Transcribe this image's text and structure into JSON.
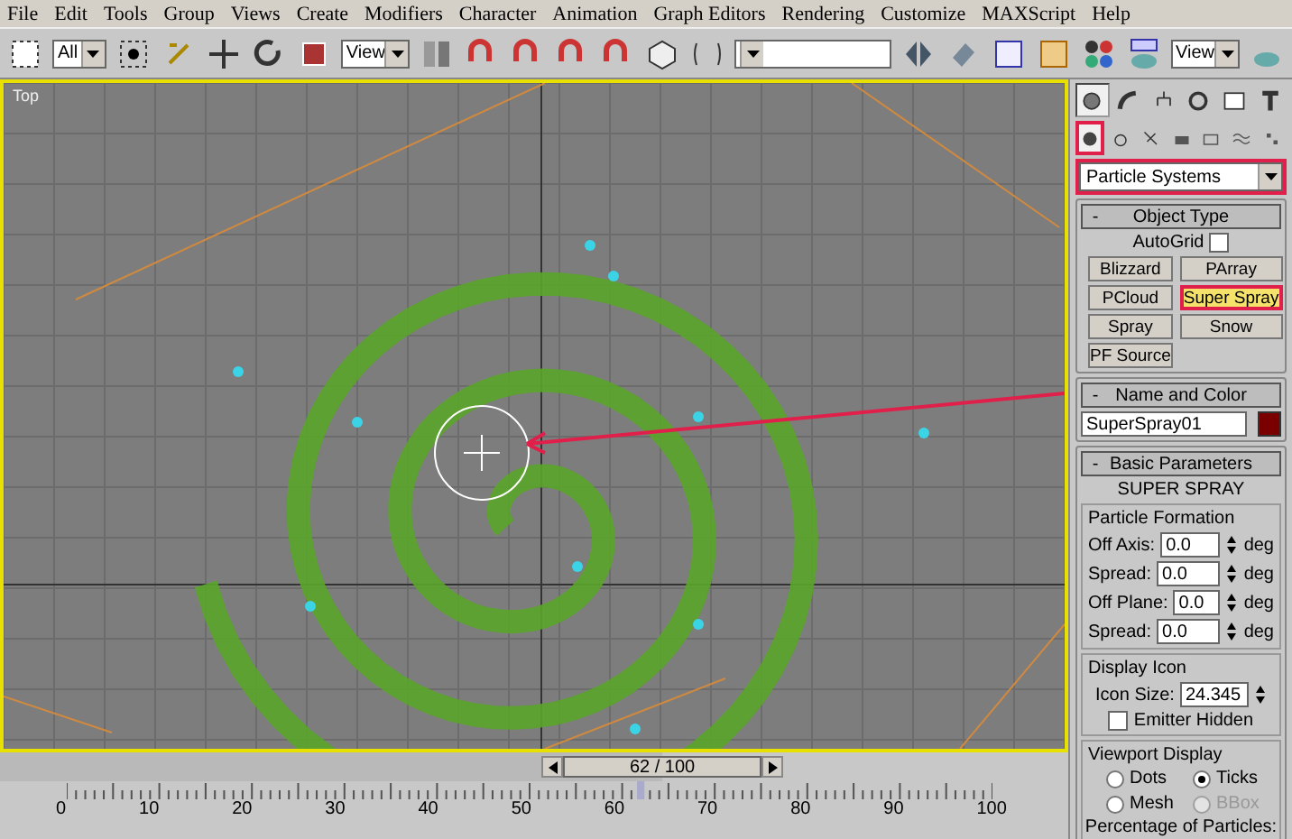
{
  "menu": [
    "File",
    "Edit",
    "Tools",
    "Group",
    "Views",
    "Create",
    "Modifiers",
    "Character",
    "Animation",
    "Graph Editors",
    "Rendering",
    "Customize",
    "MAXScript",
    "Help"
  ],
  "toolbar": {
    "selection_filter": "All",
    "reference_coord": "View",
    "render_type": "View"
  },
  "viewport": {
    "label": "Top"
  },
  "time_slider": {
    "reading": "62 / 100",
    "level": 0.62
  },
  "track_bar": {
    "labels": [
      "0",
      "10",
      "20",
      "30",
      "40",
      "50",
      "60",
      "70",
      "80",
      "90",
      "100"
    ]
  },
  "command_panel": {
    "main_tabs": [
      {
        "kind": "create",
        "selected": true
      },
      {
        "kind": "modify",
        "selected": false
      },
      {
        "kind": "hierarchy",
        "selected": false
      },
      {
        "kind": "motion",
        "selected": false
      },
      {
        "kind": "display",
        "selected": false
      },
      {
        "kind": "utilities",
        "selected": false
      }
    ],
    "create_tabs": [
      {
        "kind": "geometry",
        "selected": true,
        "highlighted": true
      },
      {
        "kind": "shapes",
        "selected": false,
        "highlighted": false
      },
      {
        "kind": "lights",
        "selected": false,
        "highlighted": false
      },
      {
        "kind": "cameras",
        "selected": false,
        "highlighted": false
      },
      {
        "kind": "helpers",
        "selected": false,
        "highlighted": false
      },
      {
        "kind": "spacewarps",
        "selected": false,
        "highlighted": false
      },
      {
        "kind": "systems",
        "selected": false,
        "highlighted": false
      }
    ],
    "category": {
      "value": "Particle Systems",
      "highlighted": true
    },
    "object_type": {
      "title": "Object Type",
      "collapse": "-",
      "autogrid": {
        "label": "AutoGrid",
        "checked": false
      },
      "buttons": [
        {
          "label": "Blizzard",
          "selected": false,
          "highlighted": false
        },
        {
          "label": "PArray",
          "selected": false,
          "highlighted": false
        },
        {
          "label": "PCloud",
          "selected": false,
          "highlighted": false
        },
        {
          "label": "Super Spray",
          "selected": true,
          "highlighted": true
        },
        {
          "label": "Spray",
          "selected": false,
          "highlighted": false
        },
        {
          "label": "Snow",
          "selected": false,
          "highlighted": false
        },
        {
          "label": "PF Source",
          "selected": false,
          "highlighted": false
        }
      ]
    },
    "name_and_color": {
      "title": "Name and Color",
      "collapse": "-",
      "name": "SuperSpray01",
      "color": "#7a0000"
    },
    "basic_parameters": {
      "title": "Basic Parameters",
      "collapse": "-",
      "heading": "SUPER SPRAY",
      "particle_formation": {
        "title": "Particle Formation",
        "fields": [
          {
            "label": "Off Axis:",
            "value": "0.0",
            "unit": "deg"
          },
          {
            "label": "Spread:",
            "value": "0.0",
            "unit": "deg"
          },
          {
            "label": "Off Plane:",
            "value": "0.0",
            "unit": "deg"
          },
          {
            "label": "Spread:",
            "value": "0.0",
            "unit": "deg"
          }
        ]
      },
      "display_icon": {
        "title": "Display Icon",
        "icon_size_label": "Icon Size:",
        "icon_size": "24.345",
        "emitter_hidden": {
          "label": "Emitter Hidden",
          "checked": false
        }
      },
      "viewport_display": {
        "title": "Viewport Display",
        "options": [
          {
            "label": "Dots",
            "selected": false,
            "disabled": false
          },
          {
            "label": "Ticks",
            "selected": true,
            "disabled": false
          },
          {
            "label": "Mesh",
            "selected": false,
            "disabled": false
          },
          {
            "label": "BBox",
            "selected": false,
            "disabled": true
          }
        ],
        "percentage_label": "Percentage of Particles:"
      }
    }
  }
}
